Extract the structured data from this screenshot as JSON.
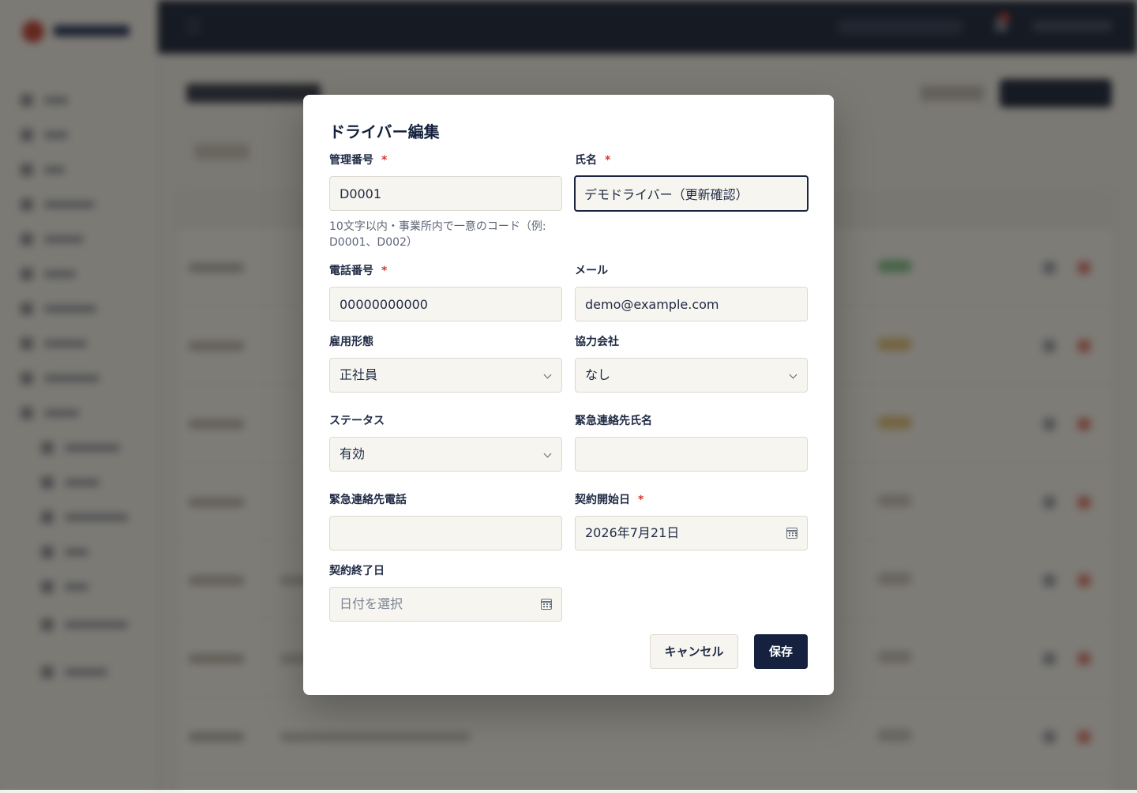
{
  "modal": {
    "title": "ドライバー編集",
    "required_mark": "*",
    "fields": {
      "management_no": {
        "label": "管理番号",
        "value": "D0001",
        "hint": "10文字以内・事業所内で一意のコード（例: D0001、D002）"
      },
      "name": {
        "label": "氏名",
        "value": "デモドライバー（更新確認）"
      },
      "phone": {
        "label": "電話番号",
        "value": "00000000000"
      },
      "email": {
        "label": "メール",
        "value": "demo@example.com"
      },
      "employment_type": {
        "label": "雇用形態",
        "value": "正社員"
      },
      "partner_company": {
        "label": "協力会社",
        "value": "なし"
      },
      "status": {
        "label": "ステータス",
        "value": "有効"
      },
      "emergency_name": {
        "label": "緊急連絡先氏名",
        "value": ""
      },
      "emergency_phone": {
        "label": "緊急連絡先電話",
        "value": ""
      },
      "contract_start": {
        "label": "契約開始日",
        "value": "2026年7月21日"
      },
      "contract_end": {
        "label": "契約終了日",
        "value": "",
        "placeholder": "日付を選択"
      }
    },
    "buttons": {
      "cancel": "キャンセル",
      "save": "保存"
    }
  },
  "icons": {
    "select_arrow": "chevron-down-icon",
    "date_picker": "calendar-icon"
  },
  "colors": {
    "primary": "#15213f",
    "required": "#d23a2f",
    "topbar": "#0f1a33"
  }
}
